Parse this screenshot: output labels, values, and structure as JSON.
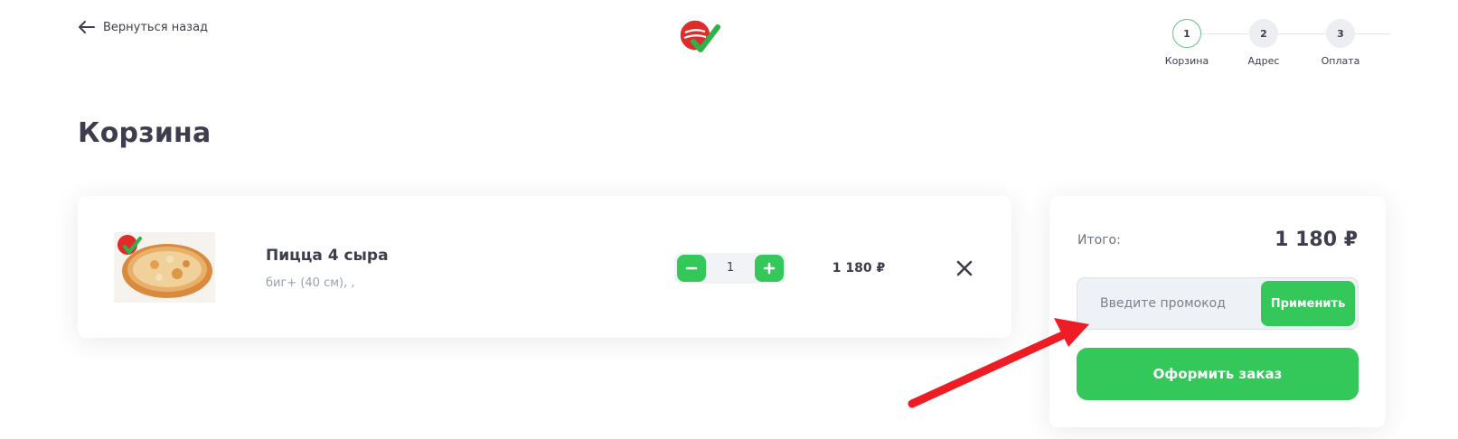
{
  "header": {
    "back_label": "Вернуться назад",
    "back_icon": "arrow-left-icon",
    "logo_icon": "brand-logo"
  },
  "steps": [
    {
      "number": "1",
      "label": "Корзина",
      "active": true
    },
    {
      "number": "2",
      "label": "Адрес",
      "active": false
    },
    {
      "number": "3",
      "label": "Оплата",
      "active": false
    }
  ],
  "page_title": "Корзина",
  "cart": {
    "items": [
      {
        "name": "Пицца 4 сыра",
        "description": "биг+ (40 см), ,",
        "quantity": "1",
        "price": "1 180 ₽"
      }
    ]
  },
  "summary": {
    "total_label": "Итого:",
    "total_value": "1 180 ₽",
    "promo_placeholder": "Введите промокод",
    "apply_label": "Применить",
    "checkout_label": "Оформить заказ"
  },
  "colors": {
    "accent": "#34c759",
    "text": "#3d3d4e",
    "annotation": "#ee1c25"
  }
}
